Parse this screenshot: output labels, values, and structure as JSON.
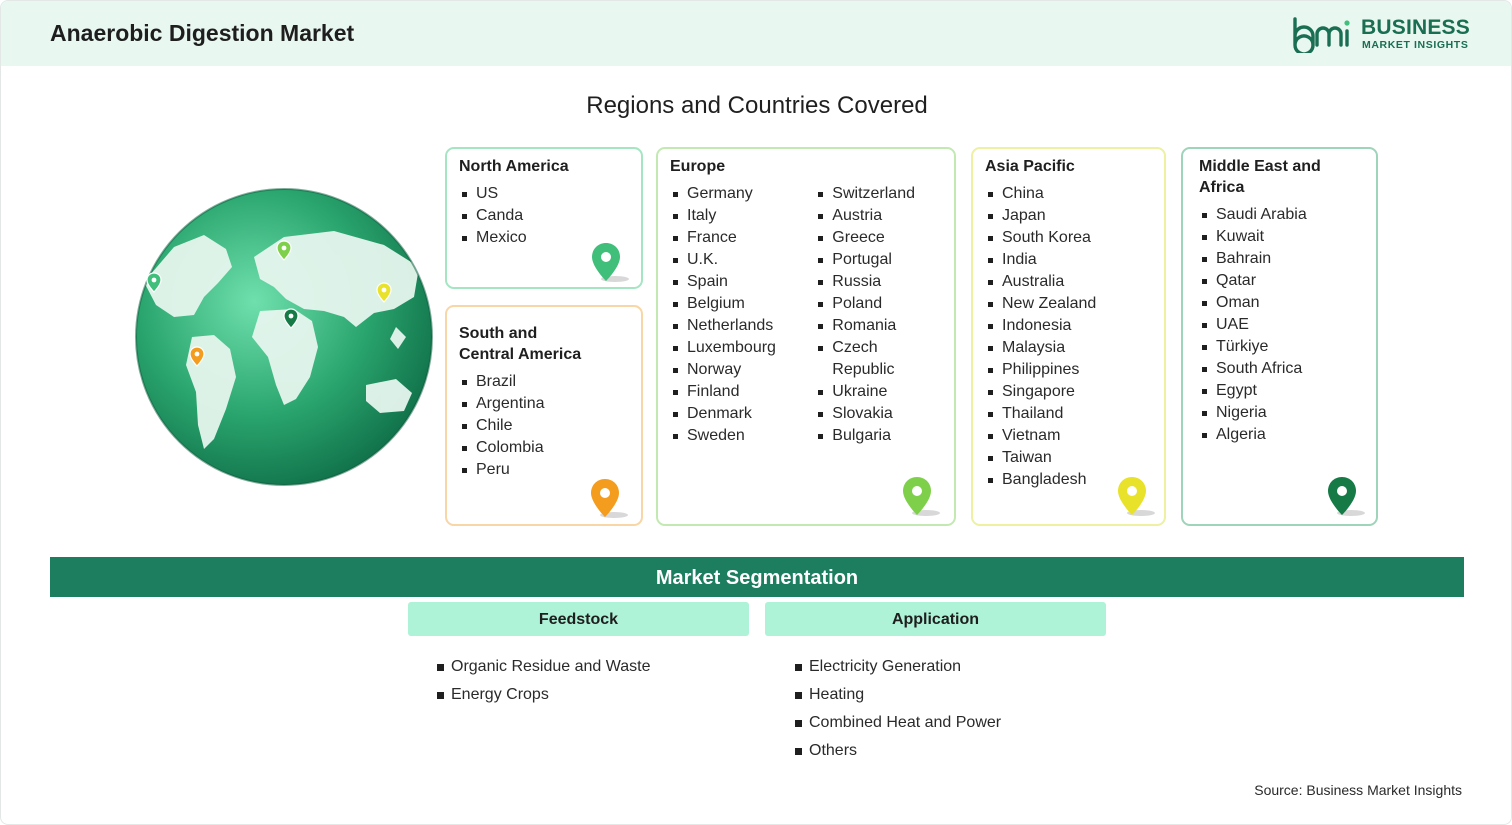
{
  "header": {
    "title": "Anaerobic Digestion Market"
  },
  "logo": {
    "word1": "BUSINESS",
    "word2": "MARKET INSIGHTS",
    "brand_color": "#1a6e52"
  },
  "regions": {
    "title": "Regions and Countries Covered",
    "north_america": {
      "title": "North America",
      "items": [
        "US",
        "Canda",
        "Mexico"
      ],
      "pin_color": "#3fbf7a"
    },
    "south_central_america": {
      "title_line1": "South and",
      "title_line2": "Central America",
      "items": [
        "Brazil",
        "Argentina",
        "Chile",
        "Colombia",
        "Peru"
      ],
      "pin_color": "#f39c1e"
    },
    "europe": {
      "title": "Europe",
      "col1": [
        "Germany",
        "Italy",
        "France",
        "U.K.",
        "Spain",
        "Belgium",
        "Netherlands",
        "Luxembourg",
        "Norway",
        "Finland",
        "Denmark",
        "Sweden"
      ],
      "col2": [
        "Switzerland",
        "Austria",
        "Greece",
        "Portugal",
        "Russia",
        "Poland",
        "Romania",
        "Czech Republic",
        "Ukraine",
        "Slovakia",
        "Bulgaria"
      ],
      "pin_color": "#7ed04b"
    },
    "asia_pacific": {
      "title": "Asia Pacific",
      "items": [
        "China",
        "Japan",
        "South Korea",
        "India",
        "Australia",
        "New Zealand",
        "Indonesia",
        "Malaysia",
        "Philippines",
        "Singapore",
        "Thailand",
        "Vietnam",
        "Taiwan",
        "Bangladesh"
      ],
      "pin_color": "#e8e22a"
    },
    "middle_east_africa": {
      "title": "Middle East and Africa",
      "items": [
        "Saudi Arabia",
        "Kuwait",
        "Bahrain",
        "Qatar",
        "Oman",
        "UAE",
        "Türkiye",
        "South Africa",
        "Egypt",
        "Nigeria",
        "Algeria"
      ],
      "pin_color": "#157a45"
    }
  },
  "segmentation": {
    "title": "Market Segmentation",
    "feedstock": {
      "title": "Feedstock",
      "items": [
        "Organic Residue and Waste",
        "Energy Crops"
      ]
    },
    "application": {
      "title": "Application",
      "items": [
        "Electricity Generation",
        "Heating",
        "Combined Heat and Power",
        "Others"
      ]
    }
  },
  "source": "Source: Business Market Insights"
}
